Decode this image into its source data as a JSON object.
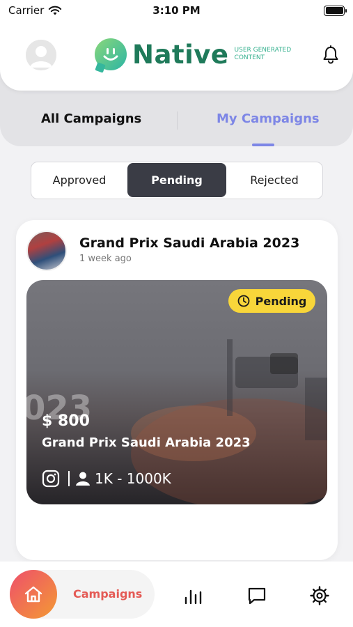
{
  "status_bar": {
    "carrier": "Carrier",
    "time": "3:10 PM"
  },
  "header": {
    "logo_text": "Native",
    "logo_tagline": "USER GENERATED CONTENT",
    "icons": {
      "avatar": "user-avatar-icon",
      "notifications": "bell-icon"
    }
  },
  "tabs": [
    {
      "label": "All Campaigns",
      "active": false
    },
    {
      "label": "My Campaigns",
      "active": true
    }
  ],
  "filters": [
    {
      "label": "Approved",
      "selected": false
    },
    {
      "label": "Pending",
      "selected": true
    },
    {
      "label": "Rejected",
      "selected": false
    }
  ],
  "campaign": {
    "title": "Grand Prix Saudi Arabia 2023",
    "posted": "1 week ago",
    "status": "Pending",
    "price": "$ 800",
    "media_title": "Grand Prix Saudi Arabia 2023",
    "media_overlay_text": "023",
    "platform": "instagram-icon",
    "followers": "1K - 1000K"
  },
  "bottom_nav": {
    "active_label": "Campaigns",
    "items": [
      "home-icon",
      "stats-icon",
      "chat-icon",
      "settings-icon"
    ]
  },
  "colors": {
    "accent_purple": "#7d86e6",
    "pending_badge": "#f8d63a",
    "segment_selected": "#3a3c45",
    "nav_gradient_start": "#ee4f6b",
    "nav_gradient_end": "#f39a34",
    "nav_label": "#e45a55",
    "logo_green": "#1f7a5a"
  }
}
